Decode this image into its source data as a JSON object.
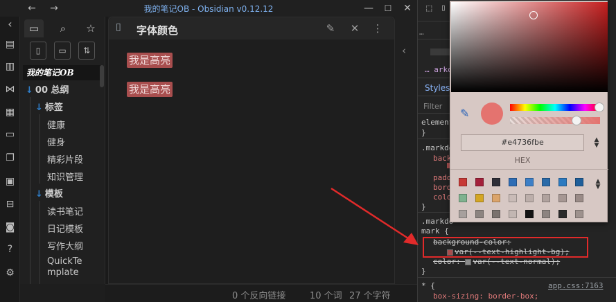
{
  "window": {
    "title": "我的笔记OB - Obsidian v0.12.12",
    "icons": [
      "back-arrow-icon",
      "forward-arrow-icon",
      "minimize-icon",
      "maximize-icon",
      "close-icon"
    ]
  },
  "ribbon": {
    "icons": [
      "collapse-left-icon",
      "markdown-importer-icon",
      "document-icon",
      "graph-view-icon",
      "calendar-icon",
      "slides-icon",
      "pages-icon",
      "blocks-icon",
      "archive-icon",
      "vault-icon",
      "help-icon",
      "settings-icon"
    ]
  },
  "sidebar": {
    "vault_name": "我的笔记OB",
    "tabs": [
      "file-explorer-icon",
      "search-icon",
      "starred-icon"
    ],
    "tools": [
      "new-note-icon",
      "new-folder-icon",
      "sort-icon"
    ],
    "tree": {
      "root": "00 总纲",
      "folder_tags": "标签",
      "tags_items": [
        "健康",
        "健身",
        "精彩片段",
        "知识管理"
      ],
      "folder_templates": "模板",
      "templates_items": [
        "读书笔记",
        "日记模板",
        "写作大纲",
        "QuickTe",
        "mplate"
      ]
    }
  },
  "editor": {
    "title": "字体颜色",
    "highlights": [
      "我是高亮",
      "我是高亮"
    ],
    "accent": "#a84e4e"
  },
  "status": {
    "backlinks": "0 个反向链接",
    "words": "10 个词",
    "chars": "27 个字符"
  },
  "devtools": {
    "ellipsis": "…",
    "crumb": "… arko",
    "tab_styles": "Styles",
    "filter": "Filter",
    "element": "element",
    "brace_close": "}",
    "rule1_selector": ".markdo",
    "rule1_props": [
      "back",
      "padd",
      "bord",
      "colo"
    ],
    "rule2_selector_a": ".markdo",
    "rule2_selector_b": "mark {",
    "decl_bg": "background-color: ",
    "decl_bg_value": "var(--text-highlight-bg);",
    "decl_color": "color: ",
    "decl_color_value": "var(--text-normal);",
    "star_rule": "* {",
    "star_source": "app.css:7163",
    "box_sizing": "box-sizing: border-box;"
  },
  "color_picker": {
    "hex_value": "#e4736fbe",
    "format_label": "HEX",
    "base_color": "#c51f1f",
    "preview_color": "#e4736f",
    "palette_row1": [
      "#c73a36",
      "#a3203a",
      "#2f2f38",
      "#2f6db5",
      "#3d7fc6",
      "#2a6aa8",
      "#2c7ac0",
      "#1f5f9a"
    ],
    "palette_row2": [
      "#7fb28f",
      "#d4a623",
      "#dba46a",
      "#c9bbb7",
      "#bcaeaa",
      "#b0a29e",
      "#a69793",
      "#9a8b87"
    ],
    "palette_row3": [
      "#a7a09d",
      "#8c8480",
      "#7a726e",
      "#c2b6b2",
      "#141414",
      "#8d8481",
      "#2a2a2a",
      "#9d918d"
    ]
  }
}
